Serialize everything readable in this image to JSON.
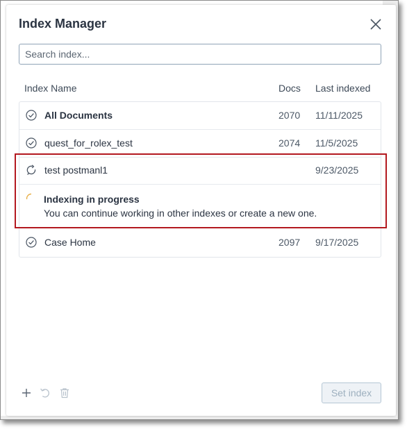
{
  "dialog": {
    "title": "Index Manager",
    "search": {
      "placeholder": "Search index...",
      "value": ""
    },
    "columns": {
      "name": "Index Name",
      "docs": "Docs",
      "last_indexed": "Last indexed"
    },
    "rows": [
      {
        "name": "All Documents",
        "docs": "2070",
        "last_indexed": "11/11/2025",
        "status_icon": "check-circle-icon",
        "selected": true
      },
      {
        "name": "quest_for_rolex_test",
        "docs": "2074",
        "last_indexed": "11/5/2025",
        "status_icon": "check-circle-icon",
        "selected": false
      },
      {
        "name": "test postmanl1",
        "docs": "",
        "last_indexed": "9/23/2025",
        "status_icon": "refresh-icon",
        "selected": false
      },
      {
        "name": "Case Home",
        "docs": "2097",
        "last_indexed": "9/17/2025",
        "status_icon": "check-circle-icon",
        "selected": false
      }
    ],
    "progress": {
      "title": "Indexing in progress",
      "message": "You can continue working in other indexes or create a new one."
    },
    "footer": {
      "set_index_label": "Set index",
      "set_index_enabled": false
    },
    "colors": {
      "title": "#2b3442",
      "highlight": "#b3181f",
      "spinner": "#e8b04a",
      "border": "#8fa3b6"
    }
  }
}
